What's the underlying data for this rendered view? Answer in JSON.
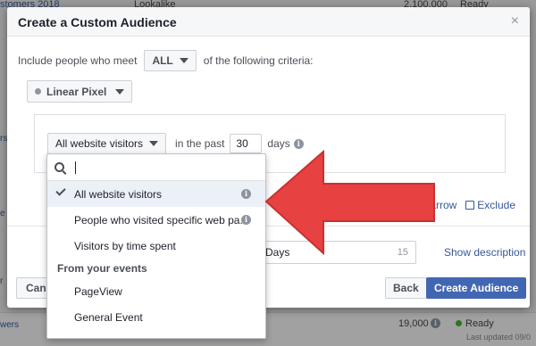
{
  "background": {
    "top_row": {
      "name": "stomers 2018",
      "type": "Lookalike",
      "size": "2,100,000",
      "status": "Ready"
    },
    "side_labels": [
      "rs",
      "e",
      "r"
    ],
    "bottom_row": {
      "name": "wers",
      "size": "19,000",
      "status": "Ready",
      "updated": "Last updated 09/0"
    }
  },
  "modal": {
    "title": "Create a Custom Audience",
    "close": "×",
    "criteria": {
      "prefix": "Include people who meet",
      "mode": "ALL",
      "suffix": "of the following criteria:"
    },
    "pixel": {
      "label": "Linear Pixel"
    },
    "rule": {
      "visitor_select": "All website visitors",
      "in_past": "in the past",
      "days_value": "30",
      "days_label": "days"
    },
    "links": {
      "narrow": "arrow",
      "exclude": "Exclude"
    },
    "retention": {
      "value": "Days",
      "counter": "15"
    },
    "show_description": "Show description",
    "footer": {
      "cancel": "Cancel",
      "back": "Back",
      "create": "Create Audience"
    }
  },
  "dropdown": {
    "search_placeholder": "",
    "items": [
      {
        "label": "All website visitors",
        "selected": true,
        "info": true
      },
      {
        "label": "People who visited specific web pa...",
        "selected": false,
        "info": true
      },
      {
        "label": "Visitors by time spent",
        "selected": false,
        "info": false
      }
    ],
    "section_label": "From your events",
    "event_items": [
      "PageView",
      "General Event"
    ]
  },
  "colors": {
    "accent": "#4267b2",
    "arrow": "#e84141",
    "ready": "#42b72a"
  },
  "icons": [
    "search-icon",
    "check-icon",
    "info-icon",
    "close-icon",
    "caret-down-icon",
    "exclude-icon",
    "arrow-annotation"
  ]
}
